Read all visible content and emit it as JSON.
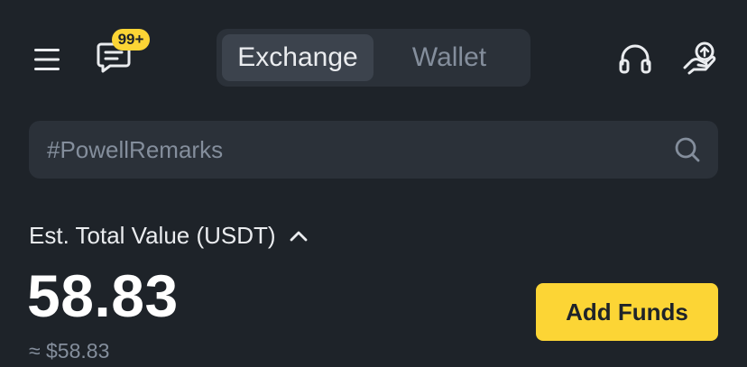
{
  "header": {
    "menu_icon": "hamburger-menu-icon",
    "chat_icon": "chat-message-icon",
    "chat_badge": "99+",
    "support_icon": "headset-support-icon",
    "gift_icon": "gift-hand-icon",
    "tabs": [
      {
        "label": "Exchange",
        "active": true
      },
      {
        "label": "Wallet",
        "active": false
      }
    ]
  },
  "search": {
    "placeholder": "#PowellRemarks",
    "value": "",
    "icon": "search-icon"
  },
  "balance": {
    "label": "Est. Total Value (USDT)",
    "toggle_icon": "chevron-up-icon",
    "value": "58.83",
    "approx": "≈ $58.83"
  },
  "actions": {
    "add_funds_label": "Add Funds"
  },
  "colors": {
    "background": "#1e2329",
    "surface": "#2b3139",
    "accent": "#fcd535",
    "text_primary": "#eaecef",
    "text_secondary": "#848e9c"
  }
}
